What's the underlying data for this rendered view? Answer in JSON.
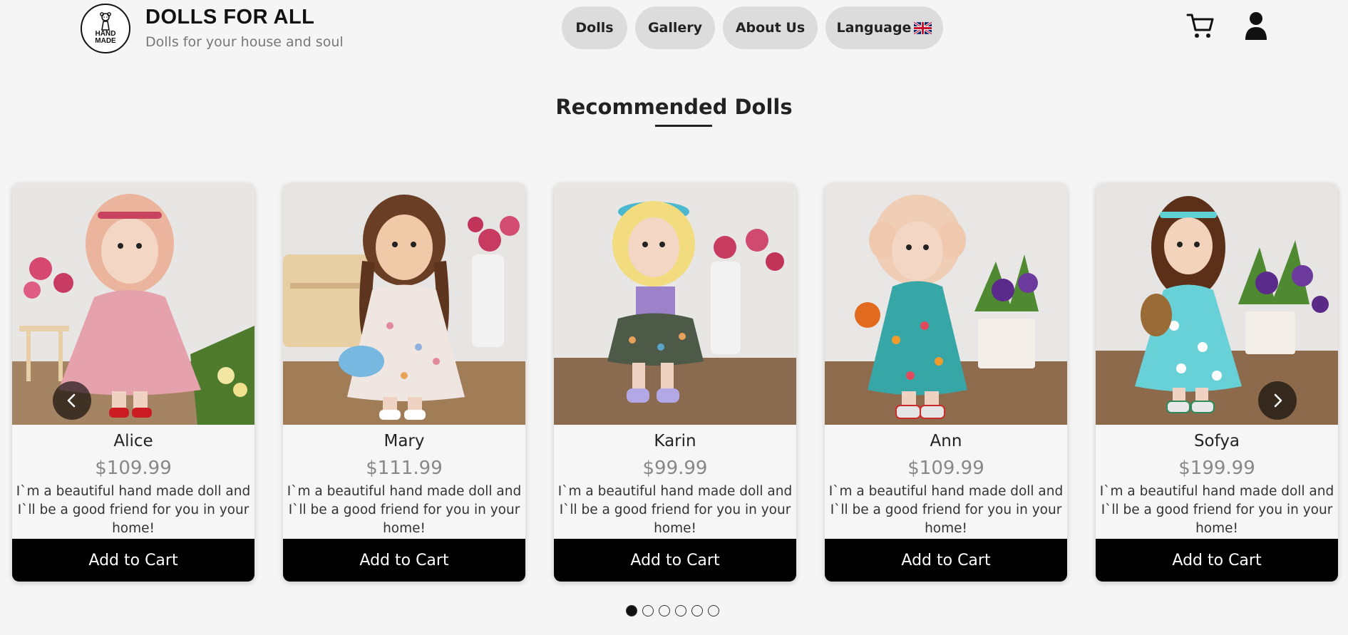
{
  "header": {
    "logo_text": [
      "HAND",
      "MADE"
    ],
    "brand_title": "DOLLS FOR ALL",
    "brand_subtitle": "Dolls for your house and soul",
    "nav": {
      "dolls": "Dolls",
      "gallery": "Gallery",
      "about": "About Us",
      "language": "Language"
    },
    "icons": {
      "flag": "uk-flag-icon",
      "cart": "cart-icon",
      "user": "user-icon"
    }
  },
  "section": {
    "title": "Recommended Dolls"
  },
  "cards": [
    {
      "name": "Alice",
      "price": "$109.99",
      "description": "I`m a beautiful hand made doll and I`ll be a good friend for you in your home!",
      "button": "Add to Cart"
    },
    {
      "name": "Mary",
      "price": "$111.99",
      "description": "I`m a beautiful hand made doll and I`ll be a good friend for you in your home!",
      "button": "Add to Cart"
    },
    {
      "name": "Karin",
      "price": "$99.99",
      "description": "I`m a beautiful hand made doll and I`ll be a good friend for you in your home!",
      "button": "Add to Cart"
    },
    {
      "name": "Ann",
      "price": "$109.99",
      "description": "I`m a beautiful hand made doll and I`ll be a good friend for you in your home!",
      "button": "Add to Cart"
    },
    {
      "name": "Sofya",
      "price": "$199.99",
      "description": "I`m a beautiful hand made doll and I`ll be a good friend for you in your home!",
      "button": "Add to Cart"
    }
  ],
  "carousel": {
    "prev_icon": "chevron-left-icon",
    "next_icon": "chevron-right-icon",
    "dot_count": 6,
    "active_dot": 1
  },
  "colors": {
    "page_background": "#f5f5f5",
    "nav_button": "#dcdcdc",
    "add_to_cart": "#000000",
    "price": "#888888"
  }
}
